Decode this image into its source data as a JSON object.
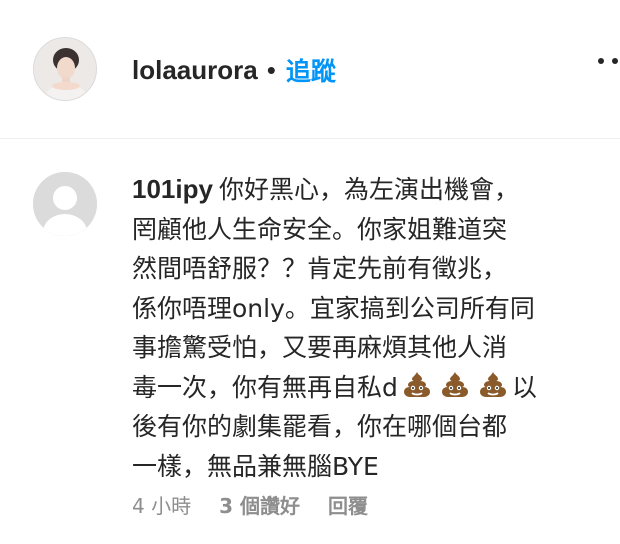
{
  "header": {
    "username": "lolaaurora",
    "separator": "•",
    "follow_label": "追蹤",
    "more_icon": "more-options-icon"
  },
  "comment": {
    "username": "101ipy",
    "lines": [
      "你好黑心，為左演出機會，",
      "罔顧他人生命安全。你家姐難道突",
      "然間唔舒服？？肯定先前有徵兆，",
      "係你唔理only。宜家搞到公司所有同",
      "事擔驚受怕，又要再麻煩其他人消"
    ],
    "line6_text": "毒一次，你有無再自私d",
    "line6_after": "以",
    "line6_emoji_icon": "pile-of-poo-icon",
    "lines_end": [
      "後有你的劇集罷看，你在哪個台都",
      "一樣，無品兼無腦BYE"
    ],
    "time": "4 小時",
    "likes": "3 個讚好",
    "reply_label": "回覆"
  },
  "colors": {
    "link": "#0095f6",
    "meta": "#8e8e8e",
    "text": "#262626"
  }
}
